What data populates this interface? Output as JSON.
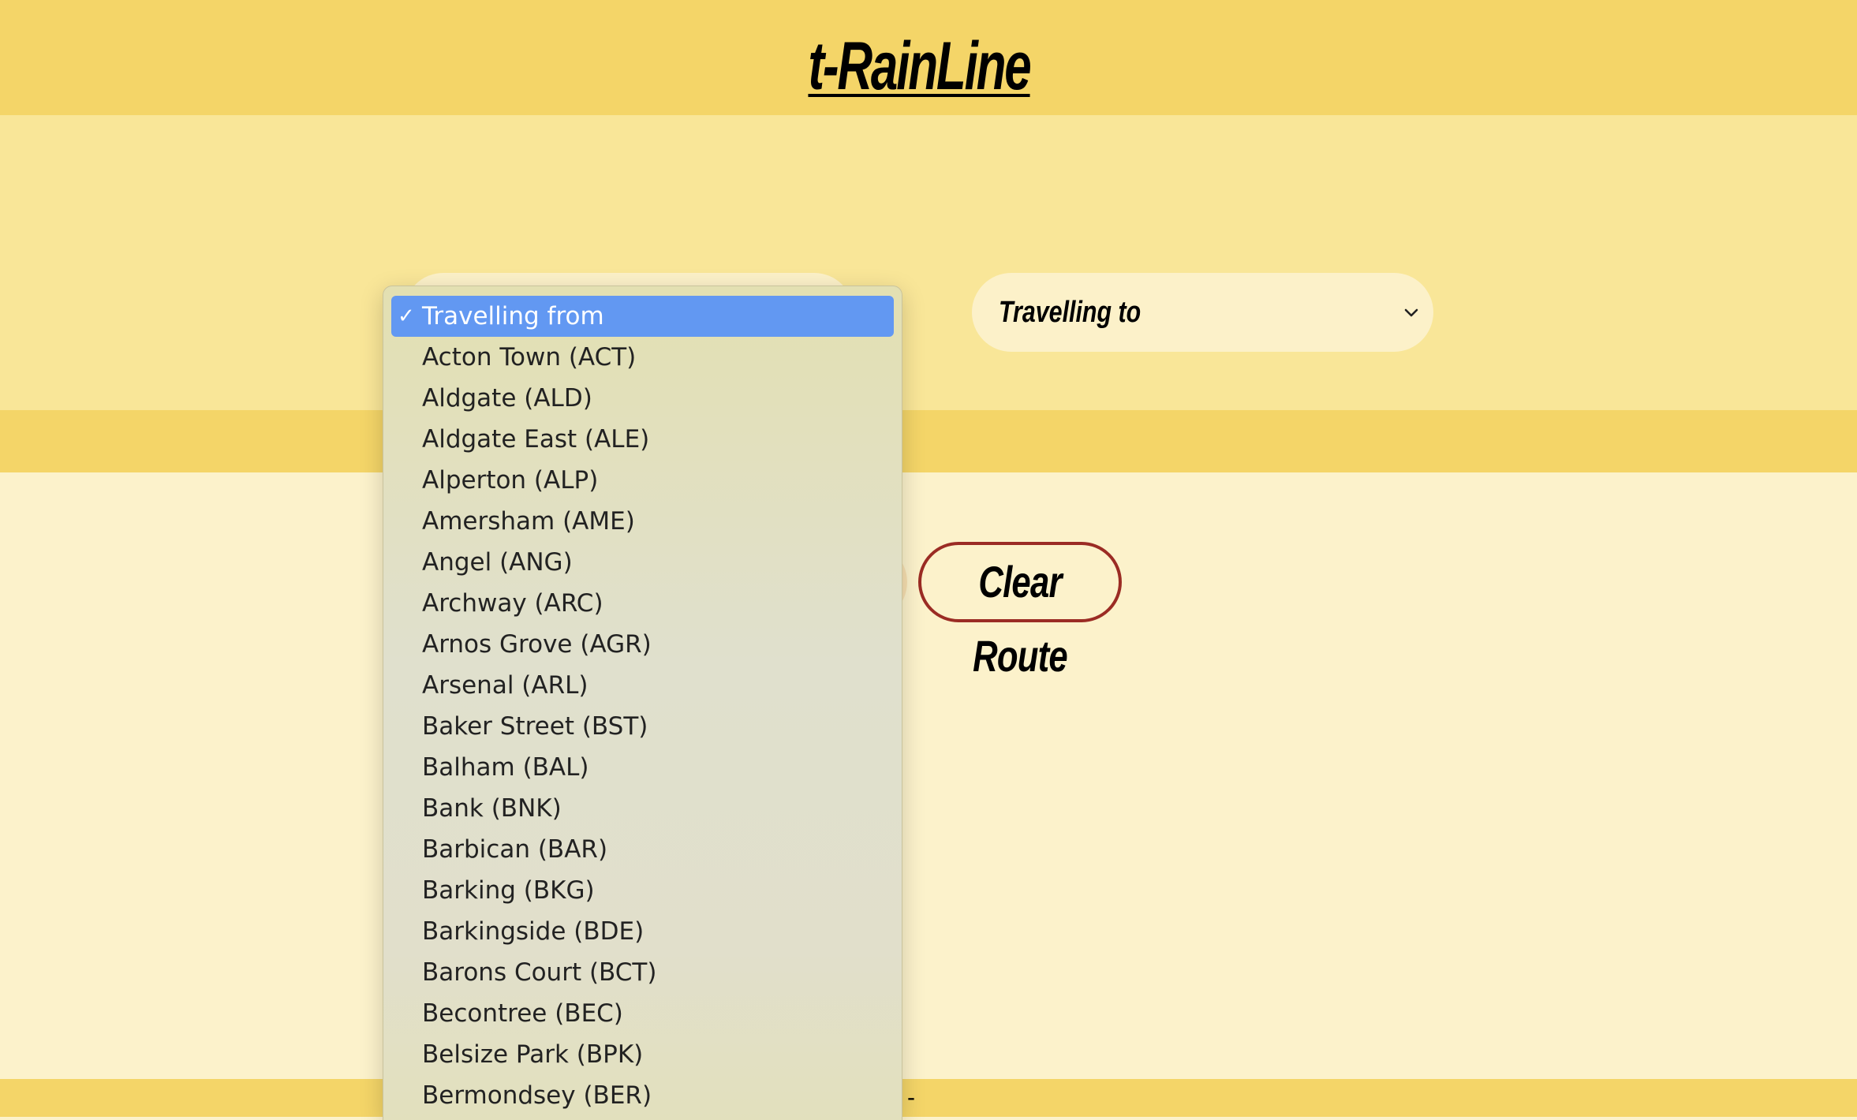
{
  "app": {
    "title": "t-RainLine"
  },
  "search": {
    "from_placeholder": "Travelling from",
    "to_placeholder": "Travelling to",
    "check_mark": "✓",
    "chevron_icon": "chevron-down-icon",
    "options": [
      "Travelling from",
      "Acton Town (ACT)",
      "Aldgate (ALD)",
      "Aldgate East (ALE)",
      "Alperton (ALP)",
      "Amersham (AME)",
      "Angel (ANG)",
      "Archway (ARC)",
      "Arnos Grove (AGR)",
      "Arsenal (ARL)",
      "Baker Street (BST)",
      "Balham (BAL)",
      "Bank (BNK)",
      "Barbican (BAR)",
      "Barking (BKG)",
      "Barkingside (BDE)",
      "Barons Court (BCT)",
      "Becontree (BEC)",
      "Belsize Park (BPK)",
      "Bermondsey (BER)"
    ]
  },
  "actions": {
    "clear_label": "Clear Route"
  },
  "footer": {
    "text": "-"
  },
  "colors": {
    "header_bg": "#f4d568",
    "search_band_bg": "#f9e698",
    "page_bg": "#fcf2cb",
    "select_bg": "#fcf1c9",
    "highlight": "#6298f2",
    "clear_border": "#9b2c24"
  }
}
